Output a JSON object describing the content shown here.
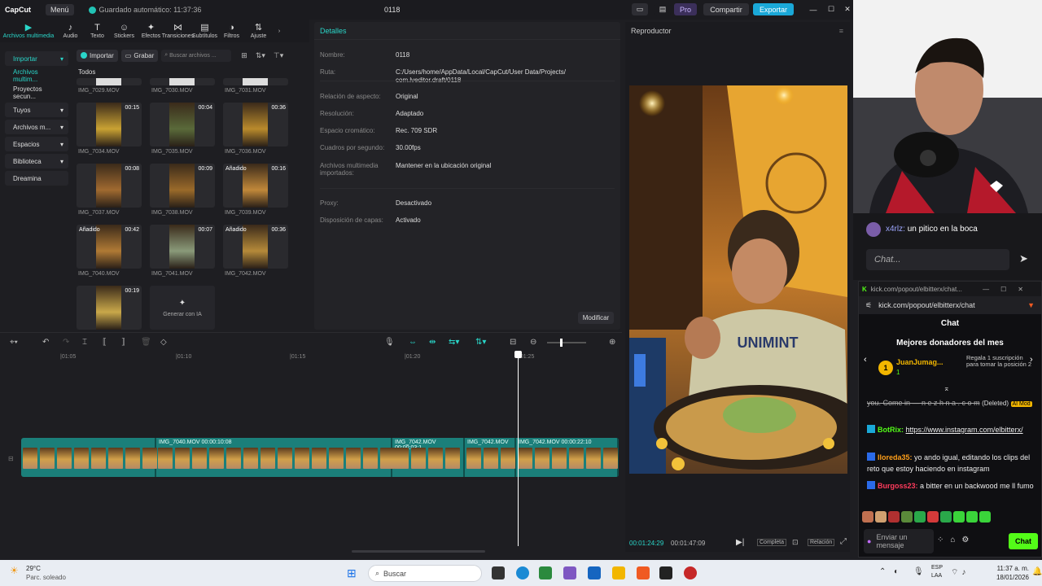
{
  "topbar": {
    "logo": "CapCut",
    "menu": "Menú",
    "autosave": "Guardado automático: 11:37:36",
    "project_title": "0118",
    "pro": "Pro",
    "share": "Compartir",
    "export": "Exportar"
  },
  "tool_tabs": [
    {
      "label": "Archivos multimedia",
      "icon": "▶"
    },
    {
      "label": "Audio",
      "icon": "♪"
    },
    {
      "label": "Texto",
      "icon": "T"
    },
    {
      "label": "Stickers",
      "icon": "☺"
    },
    {
      "label": "Efectos",
      "icon": "✦"
    },
    {
      "label": "Transiciones",
      "icon": "⋈"
    },
    {
      "label": "Subtítulos",
      "icon": "▤"
    },
    {
      "label": "Filtros",
      "icon": "◑"
    },
    {
      "label": "Ajuste",
      "icon": "⇅"
    }
  ],
  "sidenav": {
    "import": "Importar",
    "items": [
      "Archivos multim...",
      "Proyectos secun...",
      "Tuyos",
      "Archivos m...",
      "Espacios",
      "Biblioteca",
      "Dreamina"
    ]
  },
  "media": {
    "import_btn": "Importar",
    "record_btn": "Grabar",
    "search_placeholder": "Buscar archivos ...",
    "filter_all": "Todos",
    "top_labels": [
      "IMG_7029.MOV",
      "IMG_7030.MOV",
      "IMG_7031.MOV"
    ],
    "items": [
      {
        "name": "IMG_7034.MOV",
        "duration": "00:15",
        "added": ""
      },
      {
        "name": "IMG_7035.MOV",
        "duration": "00:04",
        "added": ""
      },
      {
        "name": "IMG_7036.MOV",
        "duration": "00:36",
        "added": ""
      },
      {
        "name": "IMG_7037.MOV",
        "duration": "00:08",
        "added": ""
      },
      {
        "name": "IMG_7038.MOV",
        "duration": "00:09",
        "added": ""
      },
      {
        "name": "IMG_7039.MOV",
        "duration": "00:16",
        "added": "Añadido"
      },
      {
        "name": "IMG_7040.MOV",
        "duration": "00:42",
        "added": "Añadido"
      },
      {
        "name": "IMG_7041.MOV",
        "duration": "00:07",
        "added": ""
      },
      {
        "name": "IMG_7042.MOV",
        "duration": "00:36",
        "added": "Añadido"
      },
      {
        "name": "",
        "duration": "00:19",
        "added": ""
      }
    ],
    "generate_ai": "Generar con IA"
  },
  "details": {
    "header": "Detalles",
    "rows": [
      {
        "label": "Nombre:",
        "value": "0118"
      },
      {
        "label": "Ruta:",
        "value": "C:/Users/home/AppData/Local/CapCut/User Data/Projects/ com.lveditor.draft/0118"
      },
      {
        "label": "Relación de aspecto:",
        "value": "Original"
      },
      {
        "label": "Resolución:",
        "value": "Adaptado"
      },
      {
        "label": "Espacio cromático:",
        "value": "Rec. 709 SDR"
      },
      {
        "label": "Cuadros por segundo:",
        "value": "30.00fps"
      },
      {
        "label": "Archivos multimedia importados:",
        "value": "Mantener en la ubicación original"
      },
      {
        "label": "Proxy:",
        "value": "Desactivado"
      },
      {
        "label": "Disposición de capas:",
        "value": "Activado"
      }
    ],
    "modify": "Modificar"
  },
  "player": {
    "header": "Reproductor",
    "current_time": "00:01:24:29",
    "total_time": "00:01:47:09",
    "full_btn": "Completa",
    "ratio_btn": "Relación"
  },
  "timeline": {
    "ruler": [
      "|01:05",
      "|01:10",
      "|01:15",
      "|01:20",
      "|01:25"
    ],
    "clips": [
      {
        "label": ""
      },
      {
        "label": "IMG_7040.MOV  00:00:10:08"
      },
      {
        "label": "IMG_7042.MOV  00:00:03:1"
      },
      {
        "label": "IMG_7042.MOV"
      },
      {
        "label": "IMG_7042.MOV  00:00:22:10"
      }
    ]
  },
  "stream_chat": {
    "top_msg_user": "x4rlz:",
    "top_msg_text": "un pitico en la boca",
    "chat_placeholder": "Chat...",
    "window_url": "kick.com/popout/elbitterx/chat...",
    "address": "kick.com/popout/elbitterx/chat",
    "title": "Chat",
    "donors_title": "Mejores donadores del mes",
    "donor_name": "JuanJumag...",
    "donor_level": "1",
    "donor_rank": "1",
    "donor_cta": "Regala 1 suscripción para tomar la posición 2",
    "messages": [
      {
        "user": "",
        "text": "you. Come in — n e z h n a . c o m",
        "tag": "(Deleted)",
        "badge": "AI Mod"
      },
      {
        "user": "BotRix:",
        "text": "https://www.instagram.com/elbitterx/",
        "tag": "",
        "badge": ""
      },
      {
        "user": "lloreda35:",
        "text": "yo ando igual, editando los clips del reto que estoy haciendo en instagram",
        "tag": "",
        "badge": ""
      },
      {
        "user": "Burgoss23:",
        "text": "a bitter en un backwood me ll fumo",
        "tag": "",
        "badge": ""
      }
    ],
    "send_placeholder": "Enviar un mensaje",
    "send_btn": "Chat"
  },
  "taskbar": {
    "weather_temp": "29°C",
    "weather_text": "Parc. soleado",
    "search": "Buscar",
    "lang": "ESP",
    "lang2": "LAA",
    "time": "11:37 a. m.",
    "date": "18/01/2026"
  }
}
